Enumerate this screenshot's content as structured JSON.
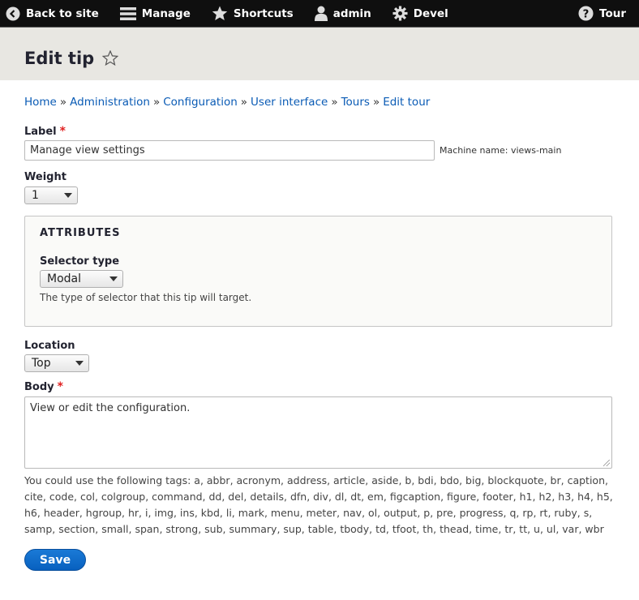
{
  "toolbar": {
    "back_label": "Back to site",
    "manage_label": "Manage",
    "shortcuts_label": "Shortcuts",
    "user_label": "admin",
    "devel_label": "Devel",
    "tour_label": "Tour"
  },
  "header": {
    "title": "Edit tip"
  },
  "breadcrumb": {
    "items": [
      "Home",
      "Administration",
      "Configuration",
      "User interface",
      "Tours",
      "Edit tour"
    ],
    "separator": "»"
  },
  "form": {
    "label": {
      "title": "Label",
      "required": "*",
      "value": "Manage view settings",
      "machine_name": "Machine name: views-main"
    },
    "weight": {
      "title": "Weight",
      "value": "1"
    },
    "attributes": {
      "legend": "ATTRIBUTES",
      "selector_type": {
        "title": "Selector type",
        "value": "Modal",
        "description": "The type of selector that this tip will target."
      }
    },
    "location": {
      "title": "Location",
      "value": "Top"
    },
    "body": {
      "title": "Body",
      "required": "*",
      "value": "View or edit the configuration.",
      "help": "You could use the following tags: a, abbr, acronym, address, article, aside, b, bdi, bdo, big, blockquote, br, caption, cite, code, col, colgroup, command, dd, del, details, dfn, div, dl, dt, em, figcaption, figure, footer, h1, h2, h3, h4, h5, h6, header, hgroup, hr, i, img, ins, kbd, li, mark, menu, meter, nav, ol, output, p, pre, progress, q, rp, rt, ruby, s, samp, section, small, span, strong, sub, summary, sup, table, tbody, td, tfoot, th, thead, time, tr, tt, u, ul, var, wbr"
    },
    "save_label": "Save"
  },
  "colors": {
    "link": "#0a5bb5",
    "primary_button": "#0860bf",
    "required": "#e02020",
    "toolbar_bg": "#0f0f0f",
    "header_bg": "#e8e7e2"
  }
}
